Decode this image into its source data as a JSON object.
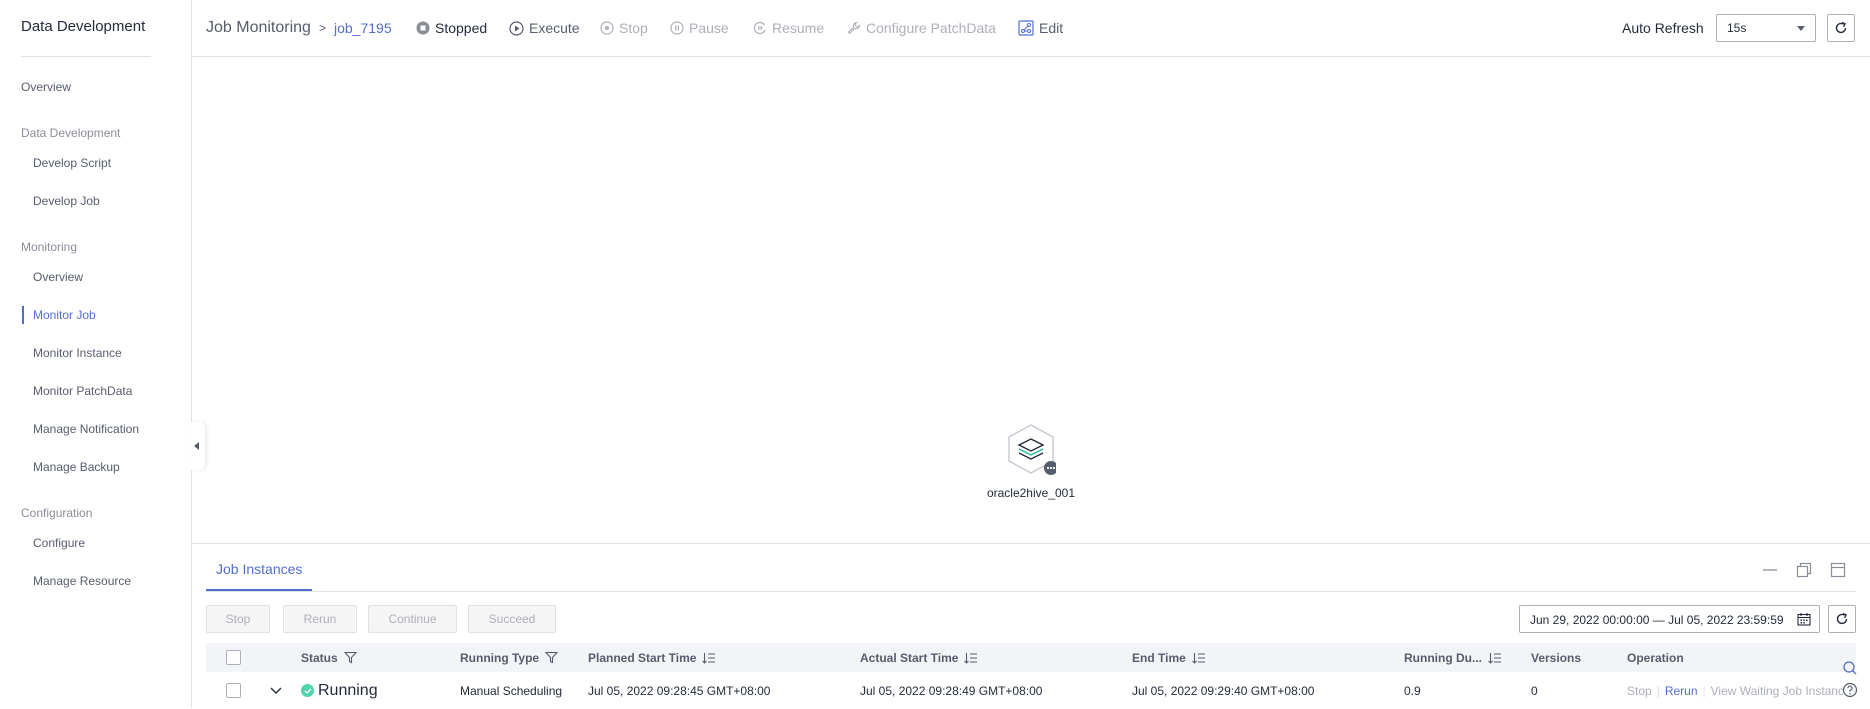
{
  "sidebar": {
    "title": "Data Development",
    "items": [
      {
        "label": "Overview"
      },
      {
        "group": "Data Development"
      },
      {
        "label": "Develop Script"
      },
      {
        "label": "Develop Job"
      },
      {
        "group": "Monitoring"
      },
      {
        "label": "Overview"
      },
      {
        "label": "Monitor Job",
        "active": true
      },
      {
        "label": "Monitor Instance"
      },
      {
        "label": "Monitor PatchData"
      },
      {
        "label": "Manage Notification"
      },
      {
        "label": "Manage Backup"
      },
      {
        "group": "Configuration"
      },
      {
        "label": "Configure"
      },
      {
        "label": "Manage Resource"
      }
    ]
  },
  "header": {
    "breadcrumb_root": "Job Monitoring",
    "breadcrumb_sep": ">",
    "breadcrumb_job": "job_7195",
    "status": "Stopped",
    "execute": "Execute",
    "stop": "Stop",
    "pause": "Pause",
    "resume": "Resume",
    "configure_patchdata": "Configure PatchData",
    "edit": "Edit",
    "auto_refresh_label": "Auto Refresh",
    "auto_refresh_value": "15s"
  },
  "canvas": {
    "node_label": "oracle2hive_001"
  },
  "bottom": {
    "tab": "Job Instances",
    "buttons": {
      "stop": "Stop",
      "rerun": "Rerun",
      "continue": "Continue",
      "succeed": "Succeed"
    },
    "date_range": "Jun 29, 2022 00:00:00 — Jul 05, 2022 23:59:59",
    "columns": {
      "status": "Status",
      "running_type": "Running Type",
      "planned_start": "Planned Start Time",
      "actual_start": "Actual Start Time",
      "end_time": "End Time",
      "running_duration": "Running Du...",
      "versions": "Versions",
      "operation": "Operation"
    },
    "rows": [
      {
        "status": "Running",
        "running_type": "Manual Scheduling",
        "planned_start": "Jul 05, 2022 09:28:45 GMT+08:00",
        "actual_start": "Jul 05, 2022 09:28:49 GMT+08:00",
        "end_time": "Jul 05, 2022 09:29:40 GMT+08:00",
        "running_duration": "0.9",
        "versions": "0",
        "op_stop": "Stop",
        "op_rerun": "Rerun",
        "op_view": "View Waiting Job Instanc"
      }
    ]
  },
  "colors": {
    "accent": "#526ecc",
    "success": "#50d4ab",
    "disabled": "#adb0b8",
    "border": "#dfe1e6"
  }
}
